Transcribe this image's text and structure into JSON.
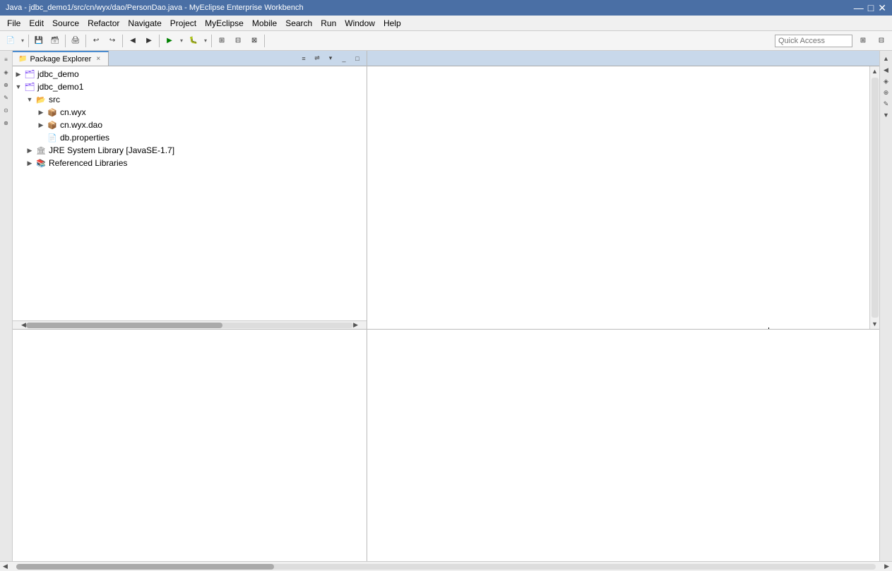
{
  "window": {
    "title": "Java - jdbc_demo1/src/cn/wyx/dao/PersonDao.java - MyEclipse Enterprise Workbench",
    "controls": [
      "—",
      "□",
      "✕"
    ]
  },
  "menu": {
    "items": [
      "File",
      "Edit",
      "Source",
      "Refactor",
      "Navigate",
      "Project",
      "MyEclipse",
      "Mobile",
      "Search",
      "Run",
      "Window",
      "Help"
    ]
  },
  "toolbar": {
    "quick_access_placeholder": "Quick Access"
  },
  "package_explorer": {
    "tab_label": "Package Explorer",
    "close": "×",
    "tree": [
      {
        "id": "jdbc_demo",
        "label": "jdbc_demo",
        "level": 0,
        "toggle": "▶",
        "icon": "project",
        "children": []
      },
      {
        "id": "jdbc_demo1",
        "label": "jdbc_demo1",
        "level": 0,
        "toggle": "▼",
        "icon": "project",
        "expanded": true,
        "children": [
          {
            "id": "src",
            "label": "src",
            "level": 1,
            "toggle": "▼",
            "icon": "src",
            "expanded": true,
            "children": [
              {
                "id": "cn.wyx",
                "label": "cn.wyx",
                "level": 2,
                "toggle": "▶",
                "icon": "package",
                "children": []
              },
              {
                "id": "cn.wyx.dao",
                "label": "cn.wyx.dao",
                "level": 2,
                "toggle": "▶",
                "icon": "package",
                "children": []
              },
              {
                "id": "db.properties",
                "label": "db.properties",
                "level": 3,
                "toggle": "",
                "icon": "properties",
                "children": []
              }
            ]
          },
          {
            "id": "jre",
            "label": "JRE System Library [JavaSE-1.7]",
            "level": 1,
            "toggle": "▶",
            "icon": "jre",
            "children": []
          },
          {
            "id": "reflibs",
            "label": "Referenced Libraries",
            "level": 1,
            "toggle": "▶",
            "icon": "reflib",
            "children": []
          }
        ]
      }
    ]
  },
  "editor": {
    "content": "",
    "cursor_visible": true
  },
  "right_sidebar": {
    "icons": [
      "▶",
      "⚙",
      "◈",
      "⊕",
      "✎"
    ]
  },
  "left_sidebar": {
    "icons": [
      "⊕",
      "⊘",
      "⊙",
      "⊗",
      "⊡",
      "⊠"
    ]
  }
}
